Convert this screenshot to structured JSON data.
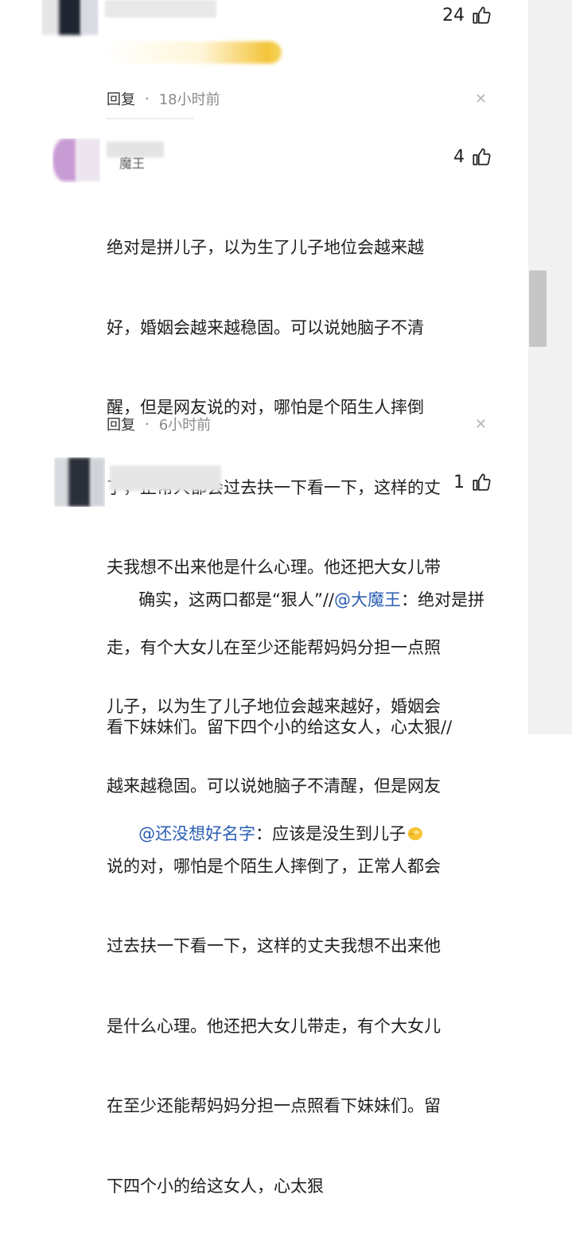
{
  "comments": [
    {
      "likes": "24",
      "reply_label": "回复",
      "time": "18小时前"
    },
    {
      "likes": "4",
      "name_fragment": "魔王",
      "lines": [
        "绝对是拼儿子，以为生了儿子地位会越来越",
        "好，婚姻会越来越稳固。可以说她脑子不清",
        "醒，但是网友说的对，哪怕是个陌生人摔倒",
        "了，正常人都会过去扶一下看一下，这样的丈",
        "夫我想不出来他是什么心理。他还把大女儿带",
        "走，有个大女儿在至少还能帮妈妈分担一点照",
        "看下妹妹们。留下四个小的给这女人，心太狠//"
      ],
      "mention": "@还没想好名字",
      "mention_rest": "：应该是没生到儿子",
      "reply_label": "回复",
      "time": "6小时前"
    },
    {
      "likes": "1",
      "line1_pre": "确实，这两口都是“狠人”//",
      "mention": "@大魔王",
      "line1_post": "：绝对是拼",
      "lines": [
        "儿子，以为生了儿子地位会越来越好，婚姻会",
        "越来越稳固。可以说她脑子不清醒，但是网友",
        "说的对，哪怕是个陌生人摔倒了，正常人都会",
        "过去扶一下看一下，这样的丈夫我想不出来他",
        "是什么心理。他还把大女儿带走，有个大女儿",
        "在至少还能帮妈妈分担一点照看下妹妹们。留",
        "下四个小的给这女人，心太狠"
      ]
    }
  ],
  "icons": {
    "like": "thumbs-up-icon",
    "close": "close-icon",
    "emoji": "thumbs-up-emoji"
  },
  "colors": {
    "mention": "#2b5fb3",
    "time": "#8a8a8a"
  }
}
